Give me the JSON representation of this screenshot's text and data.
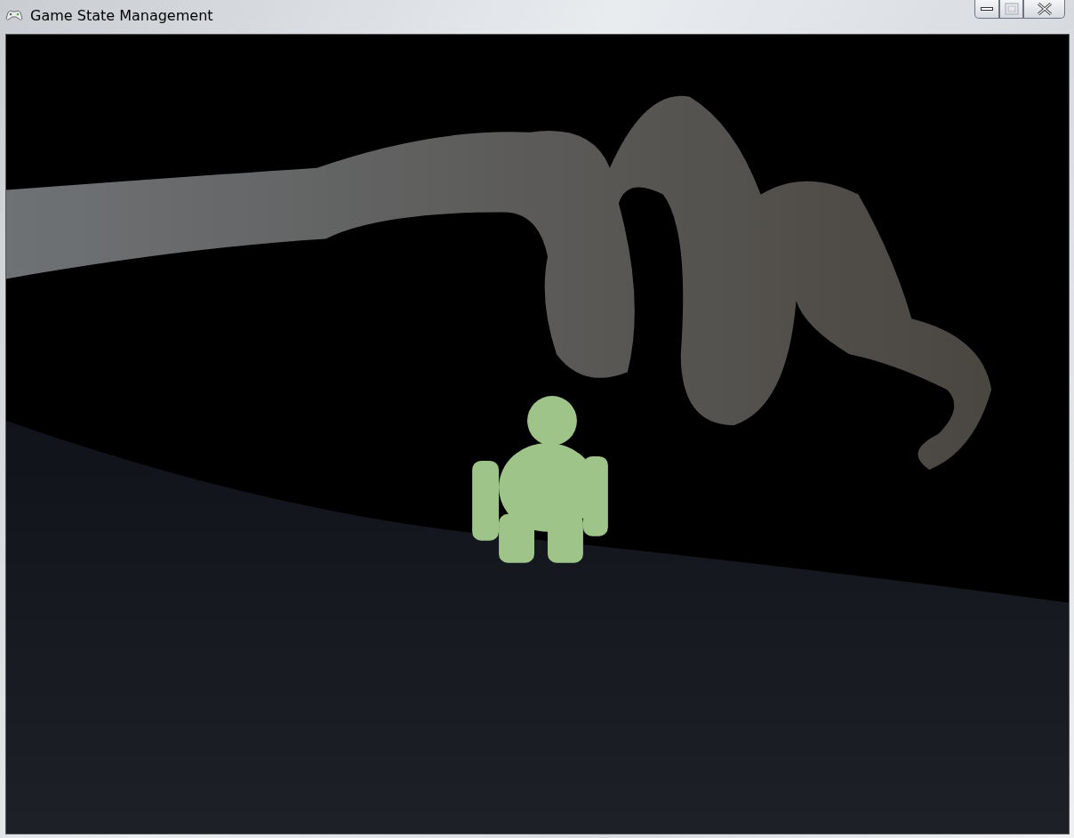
{
  "window": {
    "title": "Game State Management",
    "buttons": [
      {
        "kind": "minimize",
        "disabled": false
      },
      {
        "kind": "maximize",
        "disabled": true
      },
      {
        "kind": "close",
        "disabled": false
      }
    ]
  }
}
